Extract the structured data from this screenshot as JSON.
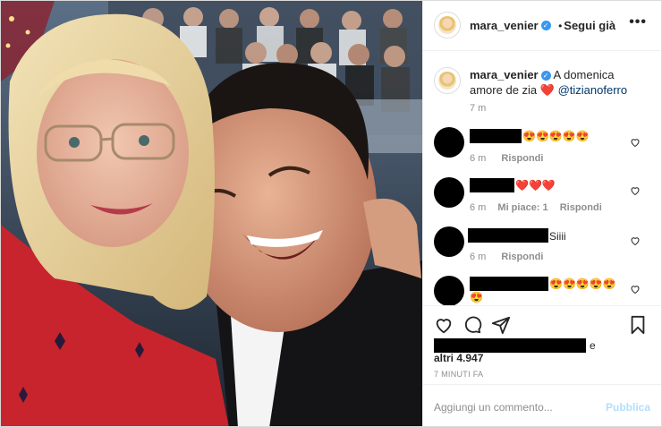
{
  "post": {
    "username": "mara_venier",
    "follow_label": "Segui già",
    "follow_dot": "•",
    "more_icon": "more-options-icon",
    "caption": {
      "username": "mara_venier",
      "text": "A domenica amore de zia ❤️",
      "mention": "@tizianoferro",
      "age": "7 m"
    },
    "comments": [
      {
        "text": "😍😍😍😍😍",
        "age": "6 m",
        "likes": "",
        "reply": "Rispondi"
      },
      {
        "text": "❤️❤️❤️",
        "age": "6 m",
        "likes": "Mi piace: 1",
        "reply": "Rispondi"
      },
      {
        "text": "Siiii",
        "age": "6 m",
        "likes": "",
        "reply": "Rispondi"
      },
      {
        "text": "😍😍😍😍😍",
        "text2": "😍",
        "age": "",
        "likes": "",
        "reply": ""
      }
    ],
    "likes_suffix": "e",
    "likes_others": "altri 4.947",
    "timestamp": "7 MINUTI FA",
    "add_comment_placeholder": "Aggiungi un commento...",
    "publish_label": "Pubblica"
  },
  "colors": {
    "accent": "#3897f0",
    "publish_disabled": "#b2dffc",
    "muted": "#8e8e8e"
  }
}
